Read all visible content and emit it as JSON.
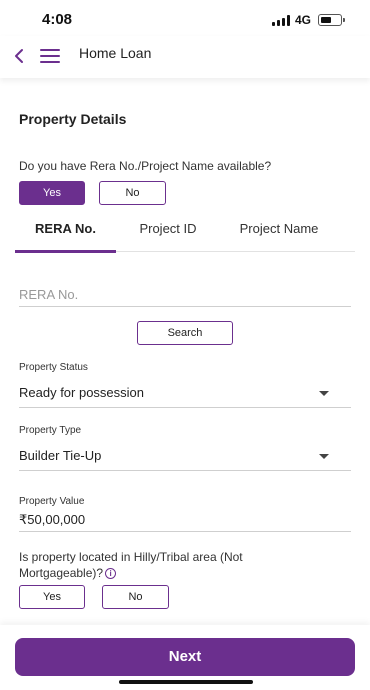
{
  "status_bar": {
    "time": "4:08",
    "network": "4G"
  },
  "header": {
    "title": "Home Loan",
    "back_icon": "chevron-left-icon",
    "menu_icon": "hamburger-menu-icon"
  },
  "property_details": {
    "title": "Property Details",
    "rera_question": "Do you have Rera No./Project Name available?",
    "rera_yes": "Yes",
    "rera_no": "No",
    "selected": "Yes"
  },
  "tabs": [
    {
      "label": "RERA No.",
      "active": true
    },
    {
      "label": "Project ID",
      "active": false
    },
    {
      "label": "Project Name",
      "active": false
    }
  ],
  "rera_search": {
    "placeholder": "RERA No.",
    "button": "Search"
  },
  "property_status": {
    "label": "Property Status",
    "value": "Ready for possession"
  },
  "property_type": {
    "label": "Property Type",
    "value": "Builder Tie-Up"
  },
  "property_value": {
    "label": "Property Value",
    "value": "₹50,00,000"
  },
  "hilly_area": {
    "question": "Is property located in Hilly/Tribal area (Not Mortgageable)?",
    "info_icon": "info-icon",
    "yes": "Yes",
    "no": "No"
  },
  "footer": {
    "next_label": "Next"
  },
  "colors": {
    "accent": "#6b2f8e"
  }
}
